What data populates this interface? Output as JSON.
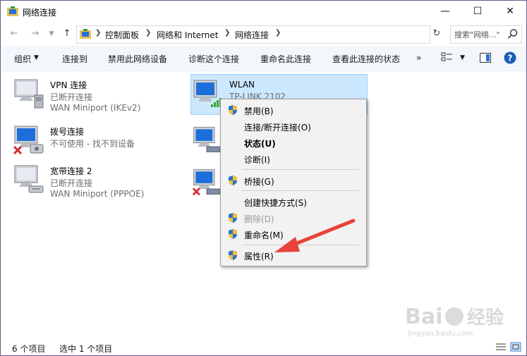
{
  "window": {
    "title": "网络连接"
  },
  "nav": {
    "crumbs": [
      "控制面板",
      "网络和 Internet",
      "网络连接"
    ],
    "search_placeholder": "搜索\"网络...\""
  },
  "commands": [
    "组织",
    "连接到",
    "禁用此网络设备",
    "诊断这个连接",
    "重命名此连接",
    "查看此连接的状态",
    "»"
  ],
  "items": [
    {
      "name": "VPN 连接",
      "status": "已断开连接",
      "device": "WAN Miniport (IKEv2)"
    },
    {
      "name": "WLAN",
      "status": "TP-LINK 2102",
      "device": ""
    },
    {
      "name": "拨号连接",
      "status": "不可使用 - 找不到设备",
      "device": ""
    },
    {
      "name": "宽带连接 2",
      "status": "已断开连接",
      "device": "WAN Miniport (PPPOE)"
    }
  ],
  "menu": [
    {
      "label": "禁用(B)",
      "shield": true,
      "bold": false,
      "disabled": false
    },
    {
      "label": "连接/断开连接(O)",
      "shield": false,
      "bold": false,
      "disabled": false
    },
    {
      "label": "状态(U)",
      "shield": false,
      "bold": true,
      "disabled": false
    },
    {
      "label": "诊断(I)",
      "shield": false,
      "bold": false,
      "disabled": false
    },
    {
      "label": "桥接(G)",
      "shield": true,
      "bold": false,
      "disabled": false
    },
    {
      "label": "创建快捷方式(S)",
      "shield": false,
      "bold": false,
      "disabled": false
    },
    {
      "label": "删除(D)",
      "shield": true,
      "bold": false,
      "disabled": true
    },
    {
      "label": "重命名(M)",
      "shield": true,
      "bold": false,
      "disabled": false
    },
    {
      "label": "属性(R)",
      "shield": true,
      "bold": false,
      "disabled": false
    }
  ],
  "status": {
    "count": "6 个项目",
    "selected": "选中 1 个项目"
  },
  "colors": {
    "selection": "#cce8ff",
    "cmdbar": "#f3f6fb",
    "arrow": "#e8423a",
    "help": "#1a5fb4"
  }
}
